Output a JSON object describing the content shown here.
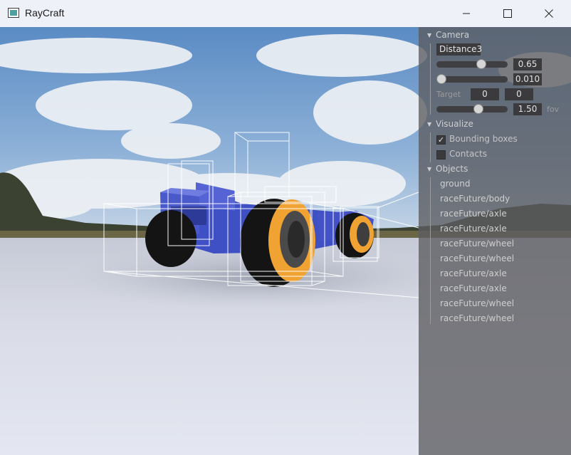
{
  "window": {
    "title": "RayCraft"
  },
  "panel": {
    "camera": {
      "header": "Camera",
      "mode": "Distance3",
      "slider1_value": "0.65",
      "slider1_level": 0.65,
      "slider2_value": "0.010",
      "slider2_level": 0.0,
      "target_label": "Target",
      "target_x": "0",
      "target_y": "0",
      "fov_value": "1.50",
      "fov_label": "fov",
      "fov_level": 0.6
    },
    "visualize": {
      "header": "Visualize",
      "bounding_label": "Bounding boxes",
      "bounding_checked": true,
      "contacts_label": "Contacts",
      "contacts_checked": false
    },
    "objects": {
      "header": "Objects",
      "items": [
        "ground",
        "raceFuture/body",
        "raceFuture/axle",
        "raceFuture/axle",
        "raceFuture/wheel",
        "raceFuture/wheel",
        "raceFuture/axle",
        "raceFuture/axle",
        "raceFuture/wheel",
        "raceFuture/wheel"
      ]
    }
  },
  "colors": {
    "car_body": "#3f4fc4",
    "rim": "#f0a232",
    "tire": "#141414"
  }
}
